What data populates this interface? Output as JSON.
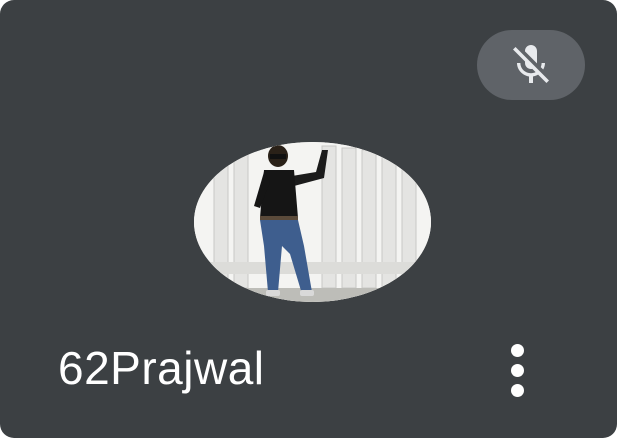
{
  "participant": {
    "name": "62Prajwal",
    "muted": true,
    "avatar_icon": "profile-photo"
  },
  "icons": {
    "mic_status": "mic-off-icon",
    "menu": "more-vert-icon"
  },
  "colors": {
    "tile_background": "#3c4043",
    "badge_background": "#5f6368",
    "name_text": "#ffffff"
  }
}
